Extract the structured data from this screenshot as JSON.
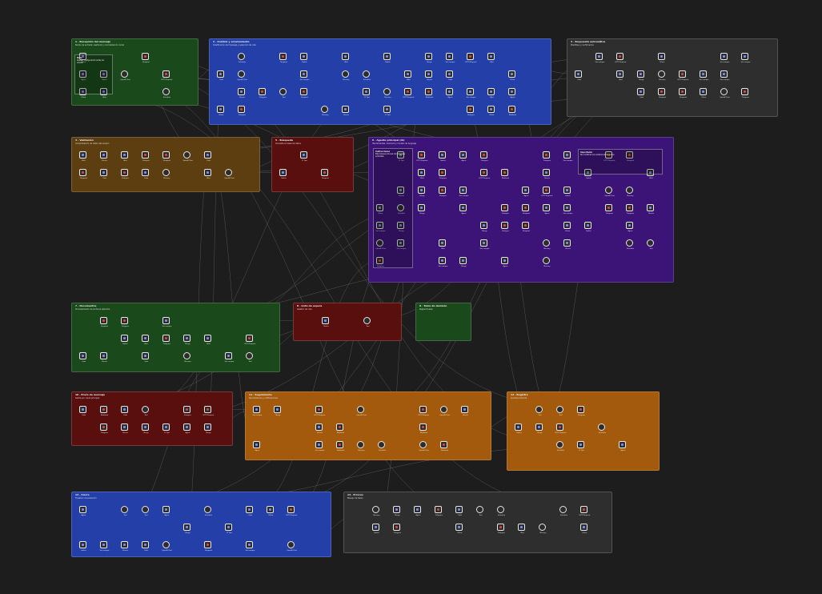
{
  "colors": {
    "background": "#1d1d1d",
    "green": "#1a4a1c",
    "blue": "#2440a8",
    "gray": "#2e2e2e",
    "brown": "#5c3e10",
    "darkred": "#5a0f0f",
    "purple": "#3c1478",
    "orange": "#a35a0c",
    "node_border": "#e8e8e8",
    "wire": "#9a9a9a"
  },
  "icons": {
    "node_red": "red-square-icon",
    "node_blue": "blue-gear-icon",
    "trigger": "circle-trigger-icon"
  },
  "groups": [
    {
      "id": "g1",
      "title": "1 · Recepción del mensaje",
      "desc": "Nodos de entrada: webhook y normalización inicial",
      "color": "green"
    },
    {
      "id": "g2",
      "title": "2 · Análisis y enrutamiento",
      "desc": "Clasificación del mensaje y selección de ruta",
      "color": "blue"
    },
    {
      "id": "g3",
      "title": "3 · Respuesta automática",
      "desc": "Plantillas y confirmación",
      "color": "gray"
    },
    {
      "id": "g4",
      "title": "4 · Validación",
      "desc": "Comprobación de datos del usuario",
      "color": "brown"
    },
    {
      "id": "g5",
      "title": "5 · Búsqueda",
      "desc": "Consulta en base de datos",
      "color": "darkred"
    },
    {
      "id": "g6",
      "title": "6 · Agente principal (IA)",
      "desc": "Herramientas, memoria y modelo de lenguaje",
      "color": "purple"
    },
    {
      "id": "g7",
      "title": "7 · Documentos",
      "desc": "Procesamiento de archivos adjuntos",
      "color": "green"
    },
    {
      "id": "g8",
      "title": "8 · Lista de espera",
      "desc": "Gestión de cola",
      "color": "darkred"
    },
    {
      "id": "g9",
      "title": "9 · Toma de decisión",
      "desc": "Reglas finales",
      "color": "green"
    },
    {
      "id": "g10",
      "title": "10 · Envío de mensaje",
      "desc": "Salida por canal principal",
      "color": "darkred"
    },
    {
      "id": "g11",
      "title": "11 · Seguimiento",
      "desc": "Recordatorios y notificaciones",
      "color": "orange"
    },
    {
      "id": "g12",
      "title": "12 · Registro",
      "desc": "Guardar historial",
      "color": "orange"
    },
    {
      "id": "g13",
      "title": "13 · Cierre",
      "desc": "Finalizar conversación",
      "color": "blue"
    },
    {
      "id": "g14",
      "title": "14 · Errores",
      "desc": "Manejo de fallos",
      "color": "gray"
    }
  ],
  "nodes": [
    {
      "label": "Webhook",
      "kind": "red"
    },
    {
      "label": "Set campos",
      "kind": "blue"
    },
    {
      "label": "Filtrar",
      "kind": "blue"
    },
    {
      "label": "IF Tipo",
      "kind": "blue"
    },
    {
      "label": "HTTP Request",
      "kind": "red"
    },
    {
      "label": "Switch",
      "kind": "blue"
    },
    {
      "label": "Merge",
      "kind": "blue"
    },
    {
      "label": "Code",
      "kind": "blue"
    },
    {
      "label": "Wait",
      "kind": "blue"
    },
    {
      "label": "Respond",
      "kind": "red"
    },
    {
      "label": "Agent",
      "kind": "blue"
    },
    {
      "label": "OpenAI Chat",
      "kind": "circle"
    },
    {
      "label": "Memory",
      "kind": "circle"
    },
    {
      "label": "Tool",
      "kind": "circle"
    },
    {
      "label": "Postgres",
      "kind": "red"
    },
    {
      "label": "Sheets",
      "kind": "blue"
    },
    {
      "label": "Telegram",
      "kind": "red"
    },
    {
      "label": "Schedule",
      "kind": "circle"
    }
  ],
  "stickies": [
    {
      "title": "Nota",
      "text": "Revisar configuración antes de activar"
    },
    {
      "title": "Instrucciones",
      "text": "Este bloque procesa los mensajes entrantes"
    },
    {
      "title": "Importante",
      "text": "No modificar los nombres de los nodos"
    }
  ]
}
